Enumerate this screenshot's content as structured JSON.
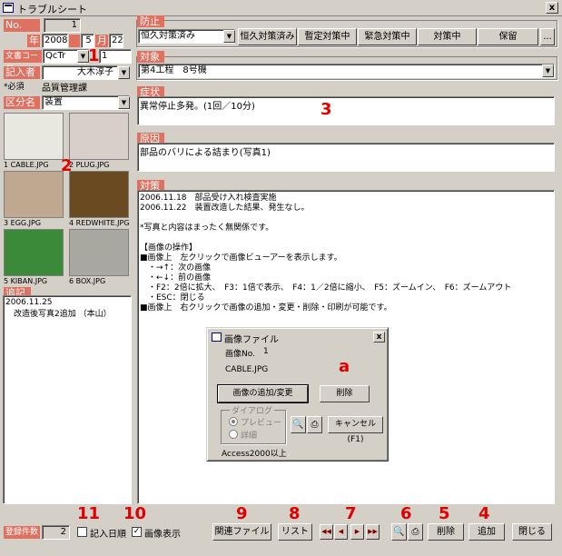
{
  "window": {
    "title": "トラブルシート",
    "close": "x"
  },
  "left": {
    "no_label": "No.",
    "no_value": "1",
    "year_label": "年",
    "year": "2008",
    "month": "5",
    "month_label": "月",
    "day": "22",
    "doccode_label": "文書コード",
    "doccode": "QcTr",
    "doccode_num": "1",
    "author_label": "記入者",
    "author": "大木淳子",
    "required": "*必須",
    "dept": "品質管理課",
    "category_label": "区分名",
    "category": "装置",
    "thumbs": [
      {
        "label": "1 CABLE.JPG",
        "color": "#e8e8e0"
      },
      {
        "label": "2 PLUG.JPG",
        "color": "#d8d0c8"
      },
      {
        "label": "3 EGG.JPG",
        "color": "#c0a890"
      },
      {
        "label": "4 REDWHITE.JPG",
        "color": "#6a4a20"
      },
      {
        "label": "5 KIBAN.JPG",
        "color": "#3a8a3a"
      },
      {
        "label": "6 BOX.JPG",
        "color": "#a8a8a0"
      }
    ],
    "notes_label": "追記",
    "notes_date": "2006.11.25",
    "notes_text": "　改造後写真2追加 （本山）"
  },
  "prevent": {
    "label": "防止",
    "status": "恒久対策済み",
    "buttons": [
      "恒久対策済み",
      "暫定対策中",
      "緊急対策中",
      "対策中",
      "保留"
    ],
    "more": "..."
  },
  "target": {
    "label": "対象",
    "value": "第4工程　8号機"
  },
  "symptom": {
    "label": "症状",
    "value": "異常停止多発。(1回／10分)"
  },
  "cause": {
    "label": "原因",
    "value": "部品のバリによる詰まり(写真1)"
  },
  "measure": {
    "label": "対策",
    "lines": [
      "2006.11.18　部品受け入れ検査実施",
      "2006.11.22　装置改造した結果、発生なし。",
      "",
      "*写真と内容はまったく無関係です。",
      "",
      "【画像の操作】",
      "■画像上　左クリックで画像ビューアーを表示します。",
      "　・→↑：次の画像",
      "　・←↓：前の画像",
      "　・F2：2倍に拡大、　F3：1倍で表示、　F4：1／2倍に縮小、　F5：ズームイン、　F6：ズームアウト",
      "　・ESC：閉じる",
      "■画像上　右クリックで画像の追加・変更・削除・印刷が可能です。"
    ]
  },
  "dialog": {
    "title": "画像ファイル",
    "no_label": "画像No.",
    "no_value": "1",
    "file": "CABLE.JPG",
    "add_btn": "画像の追加/変更",
    "del_btn": "削除",
    "dlg_group": "ダイアログ",
    "opt1": "プレビュー",
    "opt2": "詳細",
    "cancel_btn": "キャンセル(F1)",
    "footer": "Access2000以上",
    "close": "x"
  },
  "bottom": {
    "count_label": "登録件数",
    "count": "2",
    "chk1": "記入日順",
    "chk2": "画像表示",
    "chk2_mark": "✓",
    "related": "関連ファイル",
    "list": "リスト",
    "delete": "削除",
    "add": "追加",
    "close": "閉じる",
    "nav": [
      "◀◀",
      "◀",
      "▶",
      "▶▶"
    ]
  },
  "annotations": {
    "n1": "1",
    "n2": "2",
    "n3": "3",
    "a": "a",
    "n4": "4",
    "n5": "5",
    "n6": "6",
    "n7": "7",
    "n8": "8",
    "n9": "9",
    "n10": "10",
    "n11": "11"
  }
}
